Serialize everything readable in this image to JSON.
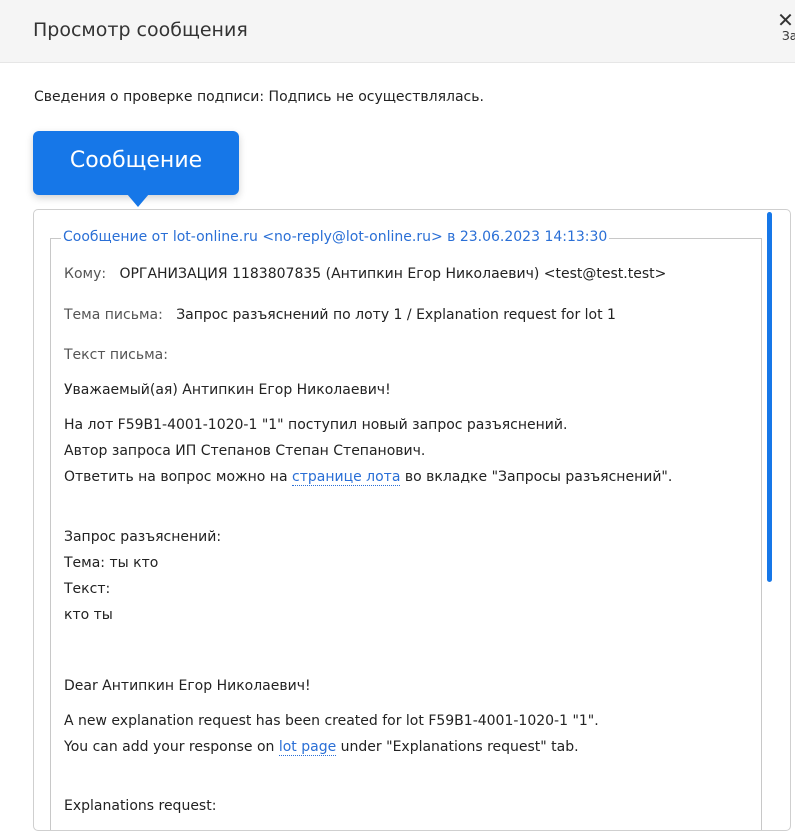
{
  "header": {
    "title": "Просмотр сообщения",
    "close_icon": "close-icon",
    "close_label": "За"
  },
  "signature_info": "Сведения о проверке подписи: Подпись не осуществлялась.",
  "tab": {
    "label": "Сообщение"
  },
  "message": {
    "legend": "Сообщение от lot-online.ru <no-reply@lot-online.ru> в 23.06.2023 14:13:30",
    "to_label": "Кому:",
    "to_value": "ОРГАНИЗАЦИЯ 1183807835 (Антипкин Егор Николаевич) <test@test.test>",
    "subject_label": "Тема письма:",
    "subject_value": "Запрос разъяснений по лоту 1 / Explanation request for lot 1",
    "body_label": "Текст письма:",
    "greeting_ru": "Уважаемый(ая) Антипкин Егор Николаевич!",
    "ru_line1": "На лот F59B1-4001-1020-1 \"1\" поступил новый запрос разъяснений.",
    "ru_line2": "Автор запроса ИП Степанов Степан Степанович.",
    "ru_line3_prefix": "Ответить на вопрос можно на",
    "ru_line3_link": "странице лота",
    "ru_line3_suffix": "во вкладке \"Запросы разъяснений\".",
    "req_title_ru": "Запрос разъяснений:",
    "req_subject_ru": "Тема: ты кто",
    "req_text_label_ru": "Текст:",
    "req_text_ru": "кто ты",
    "greeting_en": "Dear Антипкин Егор Николаевич!",
    "en_line1": "A new explanation request has been created for lot F59B1-4001-1020-1 \"1\".",
    "en_line2_prefix": "You can add your response on",
    "en_line2_link": "lot page",
    "en_line2_suffix": "under \"Explanations request\" tab.",
    "req_title_en": "Explanations request:"
  },
  "colors": {
    "accent": "#1677e8",
    "link": "#2a6fd6"
  }
}
